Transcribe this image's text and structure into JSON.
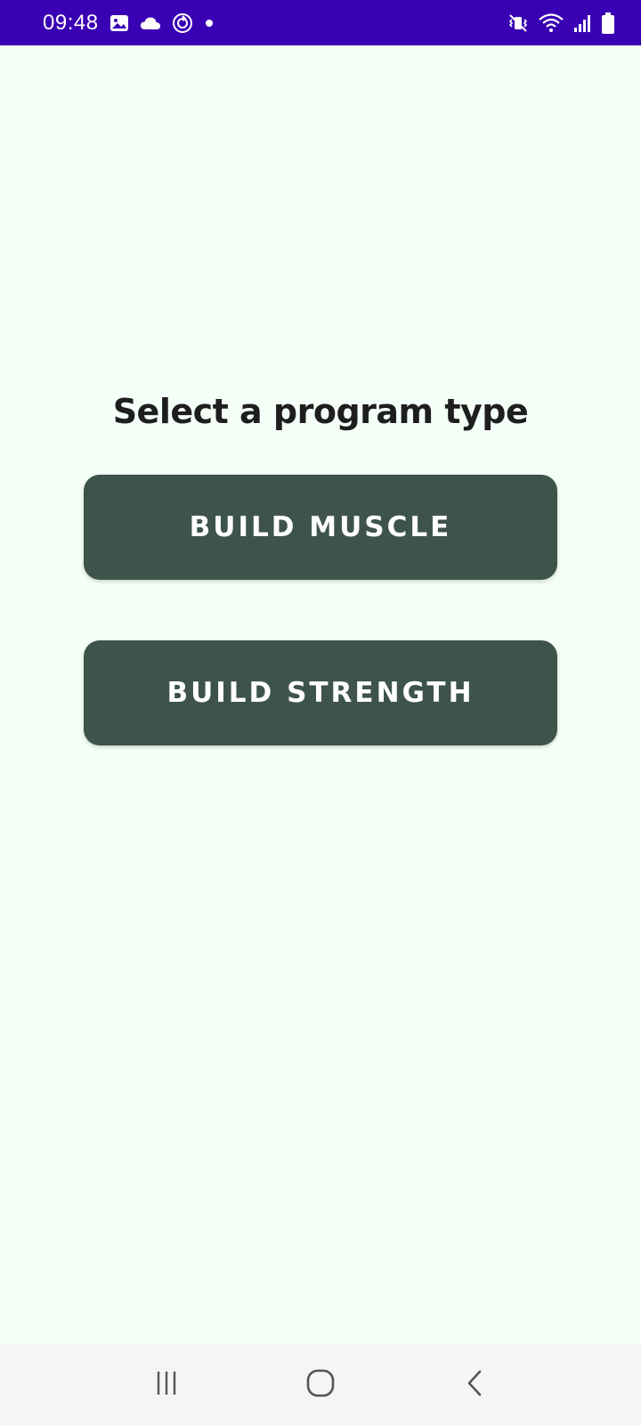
{
  "status_bar": {
    "time": "09:48",
    "background_color": "#3a00b4",
    "left_icons": [
      "gallery-icon",
      "cloud-icon",
      "sync-icon",
      "notification-dot-icon"
    ],
    "right_icons": [
      "mute-vibrate-icon",
      "wifi-icon",
      "signal-icon",
      "battery-icon"
    ]
  },
  "main": {
    "title": "Select a program type",
    "buttons": [
      {
        "label": "BUILD MUSCLE"
      },
      {
        "label": "BUILD STRENGTH"
      }
    ],
    "background_color": "#f4fff7",
    "button_color": "#3e544b"
  },
  "nav_bar": {
    "items": [
      "recent-apps-icon",
      "home-icon",
      "back-icon"
    ]
  }
}
